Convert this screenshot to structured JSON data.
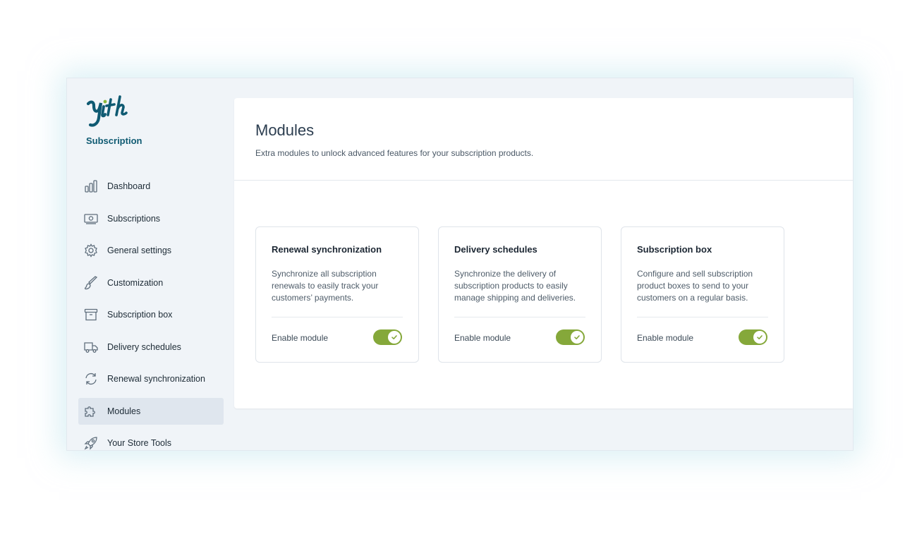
{
  "app": {
    "subtitle": "Subscription",
    "accent": "#0f5a72",
    "toggle_color": "#85a83a"
  },
  "sidebar": {
    "items": [
      {
        "label": "Dashboard",
        "icon": "bar-chart-icon",
        "active": false
      },
      {
        "label": "Subscriptions",
        "icon": "money-icon",
        "active": false
      },
      {
        "label": "General settings",
        "icon": "gear-icon",
        "active": false
      },
      {
        "label": "Customization",
        "icon": "brush-icon",
        "active": false
      },
      {
        "label": "Subscription box",
        "icon": "archive-box-icon",
        "active": false
      },
      {
        "label": "Delivery schedules",
        "icon": "truck-icon",
        "active": false
      },
      {
        "label": "Renewal synchronization",
        "icon": "sync-icon",
        "active": false
      },
      {
        "label": "Modules",
        "icon": "puzzle-icon",
        "active": true
      },
      {
        "label": "Your Store Tools",
        "icon": "rocket-icon",
        "active": false
      }
    ]
  },
  "main": {
    "title": "Modules",
    "description": "Extra modules to unlock advanced features for your subscription products.",
    "modules": [
      {
        "title": "Renewal synchronization",
        "description": "Synchronize all subscription renewals to easily track your customers’ payments.",
        "enable_label": "Enable module",
        "enabled": true
      },
      {
        "title": "Delivery schedules",
        "description": "Synchronize the delivery of subscription products to easily manage shipping and deliveries.",
        "enable_label": "Enable module",
        "enabled": true
      },
      {
        "title": "Subscription box",
        "description": "Configure and sell subscription product boxes to send to your customers on a regular basis.",
        "enable_label": "Enable module",
        "enabled": true
      }
    ]
  }
}
